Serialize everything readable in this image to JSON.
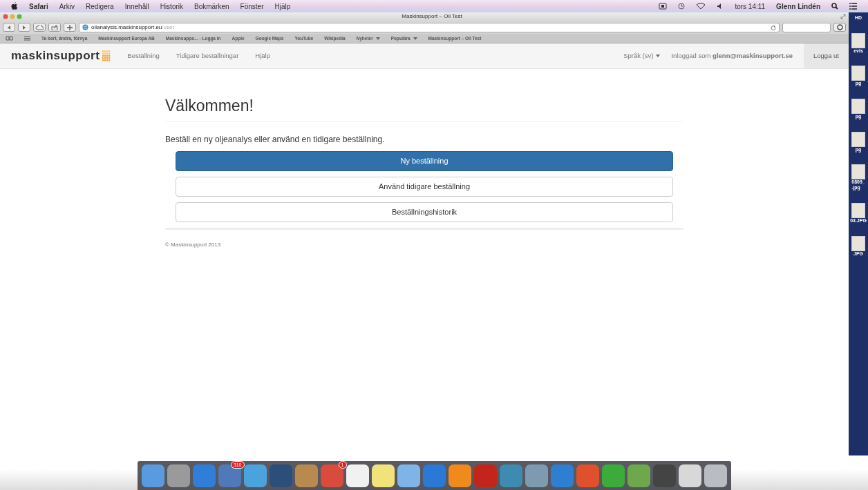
{
  "menu_bar": {
    "app": "Safari",
    "items": [
      "Arkiv",
      "Redigera",
      "Innehåll",
      "Historik",
      "Bokmärken",
      "Fönster",
      "Hjälp"
    ],
    "clock": "tors 14:11",
    "user": "Glenn Lindén"
  },
  "window": {
    "title": "Maskinsupport – Oil Test"
  },
  "address_bar": {
    "host": "oilanalysis.maskinsupport.eu",
    "path": "/user"
  },
  "bookmarks": [
    {
      "label": "Ta bort, ändra, förnya",
      "menu": false
    },
    {
      "label": "Maskinsupport Europa AB",
      "menu": false
    },
    {
      "label": "Maskinsuppo... - Logga in",
      "menu": false
    },
    {
      "label": "Apple",
      "menu": false
    },
    {
      "label": "Google Maps",
      "menu": false
    },
    {
      "label": "YouTube",
      "menu": false
    },
    {
      "label": "Wikipedia",
      "menu": false
    },
    {
      "label": "Nyheter",
      "menu": true
    },
    {
      "label": "Populära",
      "menu": true
    },
    {
      "label": "Maskinsupport – Oil Test",
      "menu": false
    }
  ],
  "navbar": {
    "brand": "maskinsupport",
    "links": [
      "Beställning",
      "Tidigare beställningar",
      "Hjälp"
    ],
    "language": "Språk (sv)",
    "login_text": "Inloggad som **glenn@maskinsupport.se**",
    "logout": "Logga ut"
  },
  "content": {
    "heading": "Välkommen!",
    "intro": "Beställ en ny oljeanalys eller använd en tidigare beställning.",
    "buttons": [
      {
        "label": "Ny beställning",
        "primary": true
      },
      {
        "label": "Använd tidigare beställning",
        "primary": false
      },
      {
        "label": "Beställningshistorik",
        "primary": false
      }
    ],
    "footer": "© Maskinsupport 2013"
  },
  "desktop_icons": [
    "HD",
    "evis",
    "pg",
    "pg",
    "pg",
    "0809_\n.jpg",
    "03.JPG",
    "JPG"
  ],
  "dock": [
    {
      "color": "#5a9be0"
    },
    {
      "color": "#9a9a9a"
    },
    {
      "color": "#2f7fd8"
    },
    {
      "color": "#4f79b8",
      "badge": "310"
    },
    {
      "color": "#4aa3df"
    },
    {
      "color": "#2b4f7a"
    },
    {
      "color": "#b98a4e"
    },
    {
      "color": "#d94b3a",
      "badge": "1"
    },
    {
      "color": "#f1f1f1"
    },
    {
      "color": "#f2e27a"
    },
    {
      "color": "#7fb4e6"
    },
    {
      "color": "#2a79d6"
    },
    {
      "color": "#f08a1c"
    },
    {
      "color": "#c4251b"
    },
    {
      "color": "#3d8bb0"
    },
    {
      "color": "#7e9ab0"
    },
    {
      "color": "#2d7fd1"
    },
    {
      "color": "#e0502c"
    },
    {
      "color": "#3bab3a"
    },
    {
      "color": "#6fa84a"
    },
    {
      "color": "#444444"
    },
    {
      "color": "#d8d8d8"
    },
    {
      "color": "#b9bcc0"
    }
  ]
}
